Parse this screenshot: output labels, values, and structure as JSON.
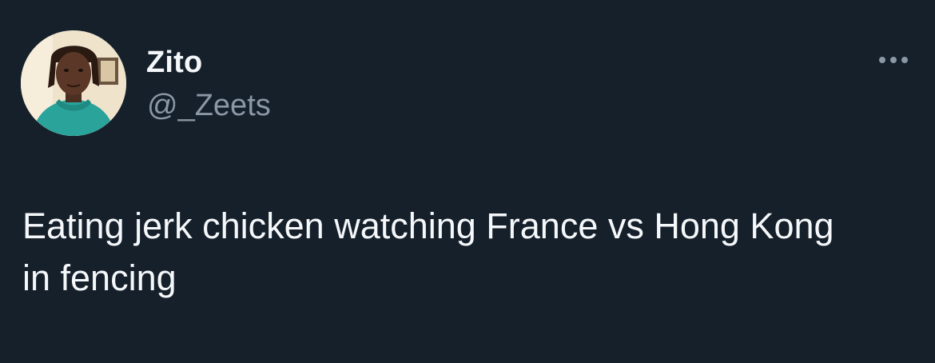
{
  "tweet": {
    "author": {
      "display_name": "Zito",
      "handle": "@_Zeets",
      "avatar_icon": "avatar-photo"
    },
    "more_icon": "more-horizontal-icon",
    "text": "Eating jerk chicken watching France vs Hong Kong in fencing"
  },
  "colors": {
    "background": "#16202b",
    "primary_text": "#f5f8fa",
    "secondary_text": "#8b98a5"
  }
}
